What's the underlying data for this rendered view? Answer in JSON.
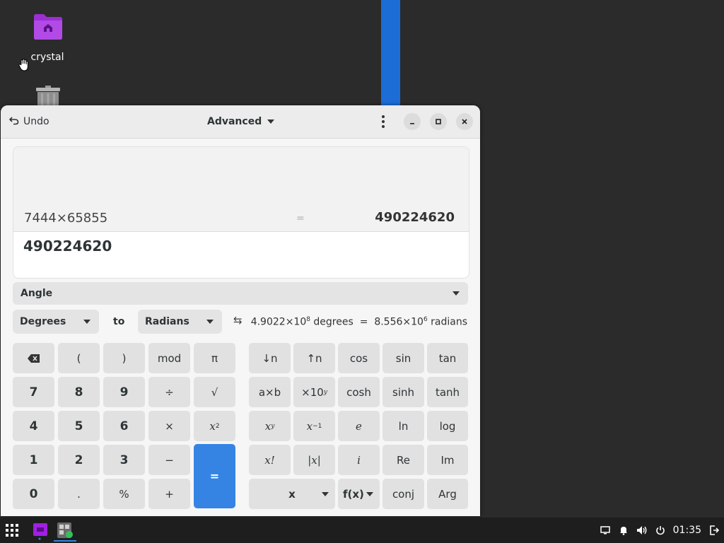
{
  "desktop": {
    "home_folder_label": "crystal"
  },
  "window": {
    "undo_label": "Undo",
    "mode_label": "Advanced"
  },
  "display": {
    "history_expression": "7444×65855",
    "history_equals": "=",
    "history_result": "490224620",
    "entry_value": "490224620"
  },
  "conversion": {
    "category": "Angle",
    "from_unit": "Degrees",
    "to_label": "to",
    "to_unit": "Radians",
    "result_from_mantissa": "4.9022×10",
    "result_from_exp": "8",
    "result_from_unit": "degrees",
    "result_equals": "=",
    "result_to_mantissa": "8.556×10",
    "result_to_exp": "6",
    "result_to_unit": "radians"
  },
  "keys": {
    "open_paren": "(",
    "close_paren": ")",
    "mod": "mod",
    "pi": "π",
    "seven": "7",
    "eight": "8",
    "nine": "9",
    "divide": "÷",
    "sqrt": "√",
    "four": "4",
    "five": "5",
    "six": "6",
    "multiply": "×",
    "one": "1",
    "two": "2",
    "three": "3",
    "minus": "−",
    "zero": "0",
    "point": ".",
    "percent": "%",
    "plus": "+",
    "equals": "=",
    "subscript": "↓n",
    "superscript": "↑n",
    "cos": "cos",
    "sin": "sin",
    "tan": "tan",
    "a_times_b": "a×b",
    "cosh": "cosh",
    "sinh": "sinh",
    "tanh": "tanh",
    "e": "e",
    "ln": "ln",
    "log": "log",
    "factorial": "x!",
    "abs": "|x|",
    "imag_unit": "i",
    "re": "Re",
    "im": "Im",
    "variable": "x",
    "function": "f(x)",
    "conj": "conj",
    "arg": "Arg"
  },
  "taskbar": {
    "clock": "01:35"
  },
  "colors": {
    "accent": "#3584e4",
    "desktop_bg": "#2b2b2b",
    "folder": "#a33ad8"
  }
}
